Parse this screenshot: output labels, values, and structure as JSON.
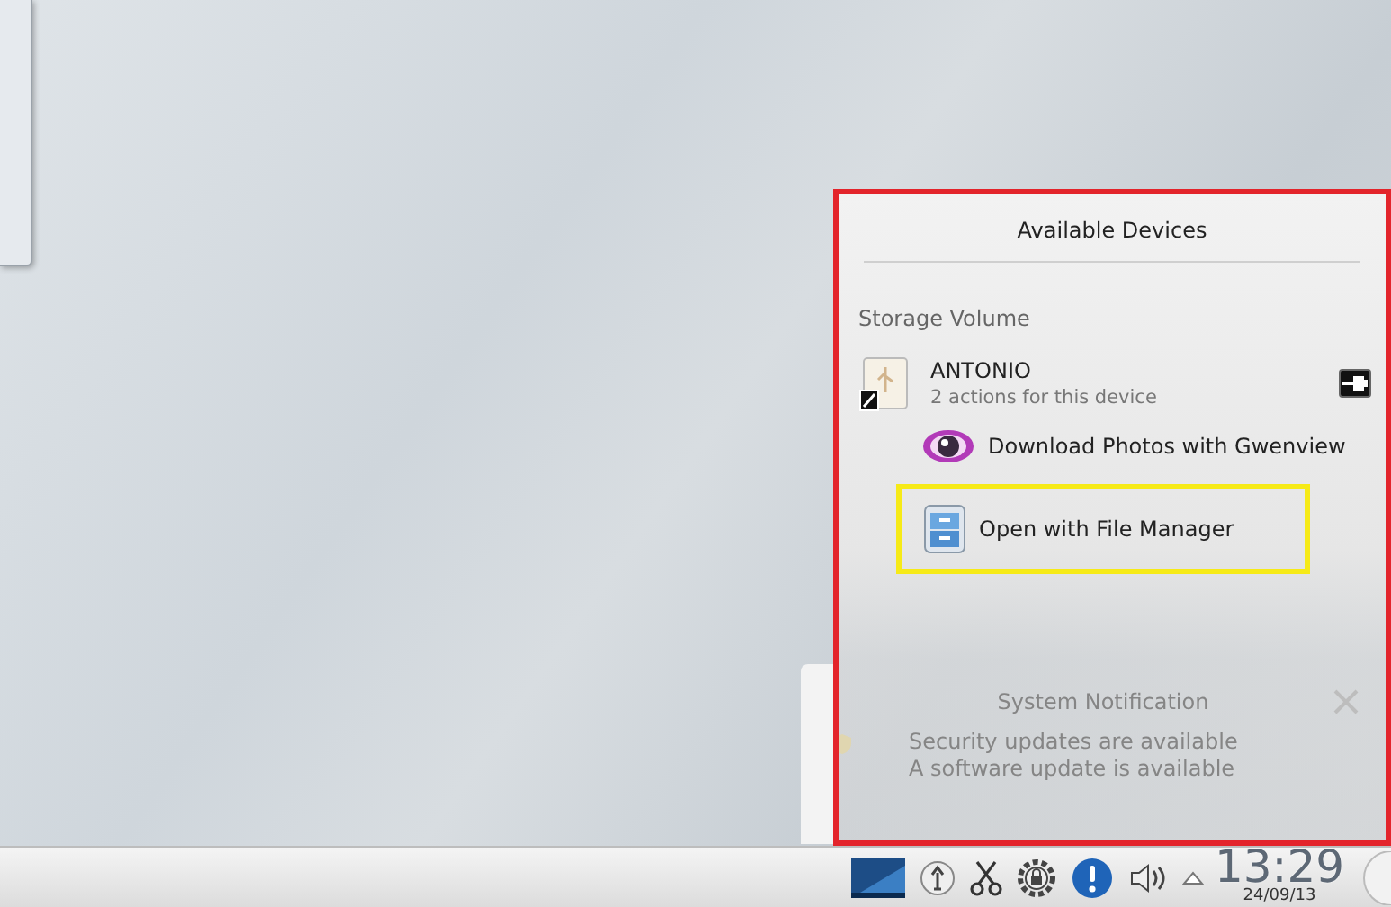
{
  "popup": {
    "title": "Available Devices",
    "section": "Storage Volume",
    "device": {
      "name": "ANTONIO",
      "subtitle": "2 actions for this device",
      "actions": [
        {
          "kind": "photos",
          "label": "Download Photos with Gwenview",
          "highlighted": false
        },
        {
          "kind": "files",
          "label": "Open with File Manager",
          "highlighted": true
        }
      ]
    }
  },
  "notification": {
    "title": "System Notification",
    "lines": [
      "Security updates are available",
      "A software update is available"
    ]
  },
  "taskbar": {
    "clock": {
      "time": "13:29",
      "date": "24/09/13"
    }
  }
}
